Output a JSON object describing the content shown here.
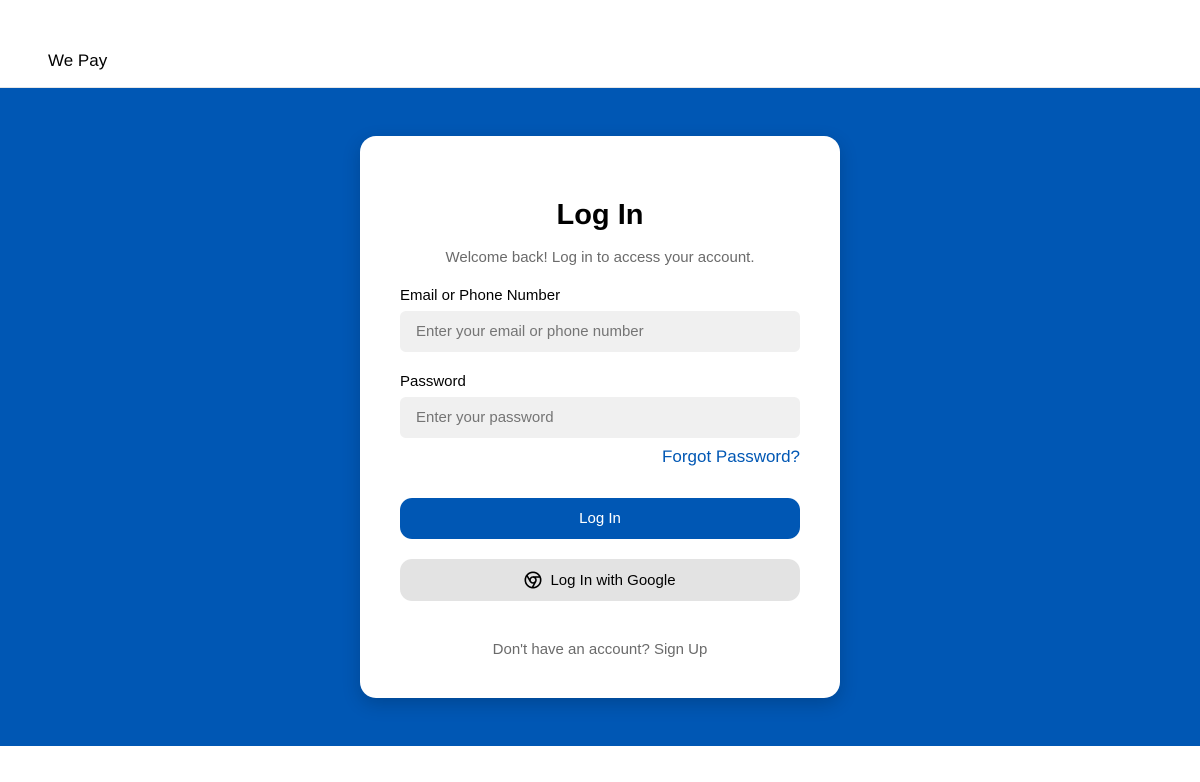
{
  "header": {
    "brand": "We Pay"
  },
  "login": {
    "title": "Log In",
    "subtitle": "Welcome back! Log in to access your account.",
    "email_label": "Email or Phone Number",
    "email_placeholder": "Enter your email or phone number",
    "email_value": "",
    "password_label": "Password",
    "password_placeholder": "Enter your password",
    "password_value": "",
    "forgot_link": "Forgot Password?",
    "login_button": "Log In",
    "google_button": "Log In with Google",
    "google_icon": "chrome-icon",
    "signup_prompt": "Don't have an account?",
    "signup_link": "Sign Up"
  },
  "colors": {
    "primary": "#0057b4",
    "input_bg": "#f0f0f0",
    "secondary_button_bg": "#e3e3e3",
    "muted_text": "#6b6b6b"
  }
}
